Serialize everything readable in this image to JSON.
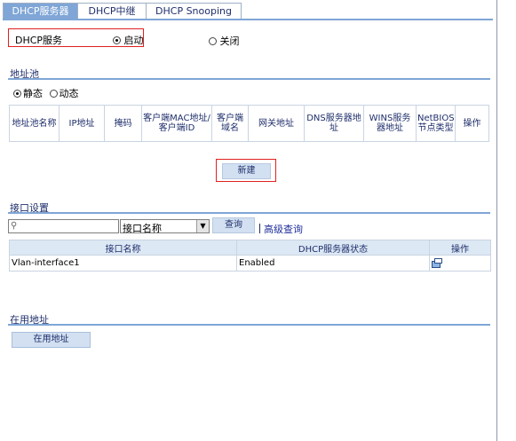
{
  "tabs": [
    {
      "label": "DHCP服务器",
      "active": true
    },
    {
      "label": "DHCP中继",
      "active": false
    },
    {
      "label": "DHCP Snooping",
      "active": false
    }
  ],
  "service": {
    "label": "DHCP服务",
    "enable_label": "启动",
    "disable_label": "关闭",
    "selected": "启动"
  },
  "pool": {
    "title": "地址池",
    "static_label": "静态",
    "dynamic_label": "动态",
    "selected": "静态",
    "columns": [
      "地址池名称",
      "IP地址",
      "掩码",
      "客户端MAC地址/客户端ID",
      "客户端域名",
      "网关地址",
      "DNS服务器地址",
      "WINS服务器地址",
      "NetBIOS节点类型",
      "操作"
    ],
    "new_button": "新建"
  },
  "interface": {
    "title": "接口设置",
    "search_value": "",
    "search_field": "接口名称",
    "query_button": "查询",
    "advanced_link": "高级查询",
    "columns": [
      "接口名称",
      "DHCP服务器状态",
      "操作"
    ],
    "rows": [
      {
        "name": "Vlan-interface1",
        "status": "Enabled",
        "action_icon": "edit-icon"
      }
    ]
  },
  "in_use": {
    "title": "在用地址",
    "button": "在用地址"
  },
  "colors": {
    "accent": "#7fa6d6",
    "highlight_border": "#e02020",
    "header_bg": "#dde8f5"
  }
}
